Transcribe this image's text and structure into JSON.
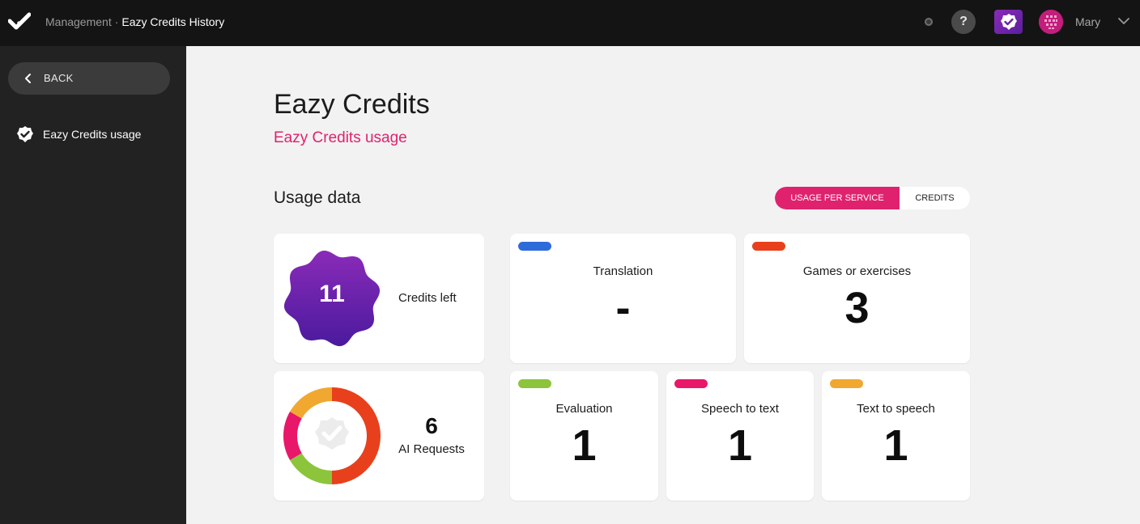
{
  "header": {
    "breadcrumb": [
      "Management",
      "Eazy Credits History"
    ],
    "separator": "·",
    "help_label": "?",
    "user_name": "Mary",
    "icons": [
      "checkmark-logo-icon",
      "status-dot-icon",
      "help-icon",
      "brand-check-icon",
      "avatar",
      "chevron-down-icon"
    ]
  },
  "sidebar": {
    "back_label": "BACK",
    "items": [
      {
        "label": "Eazy Credits usage",
        "icon": "badge-check-icon"
      }
    ]
  },
  "main": {
    "title": "Eazy Credits",
    "subtitle": "Eazy Credits usage",
    "section_title": "Usage data",
    "toggle": {
      "options": [
        "USAGE PER SERVICE",
        "CREDITS"
      ],
      "selected": "USAGE PER SERVICE"
    },
    "credits": {
      "value": "11",
      "label": "Credits left"
    },
    "ai_requests": {
      "value": "6",
      "label": "AI Requests",
      "breakdown": [
        {
          "service": "Games or exercises",
          "count": 3,
          "color": "#e8401c"
        },
        {
          "service": "Evaluation",
          "count": 1,
          "color": "#8cc43b"
        },
        {
          "service": "Speech to text",
          "count": 1,
          "color": "#e8176a"
        },
        {
          "service": "Text to speech",
          "count": 1,
          "color": "#f0a830"
        }
      ]
    },
    "services": [
      {
        "name": "Translation",
        "value": "-",
        "color": "#2d6bdb"
      },
      {
        "name": "Games or exercises",
        "value": "3",
        "color": "#e8401c"
      },
      {
        "name": "Evaluation",
        "value": "1",
        "color": "#8cc43b"
      },
      {
        "name": "Speech to text",
        "value": "1",
        "color": "#e8176a"
      },
      {
        "name": "Text to speech",
        "value": "1",
        "color": "#f0a830"
      }
    ]
  },
  "colors": {
    "accent": "#e0226e",
    "badge_gradient": [
      "#8a2bb8",
      "#4a1a9e"
    ],
    "sidebar_bg": "#222222",
    "topbar_bg": "#141414",
    "page_bg": "#f2f2f2"
  }
}
